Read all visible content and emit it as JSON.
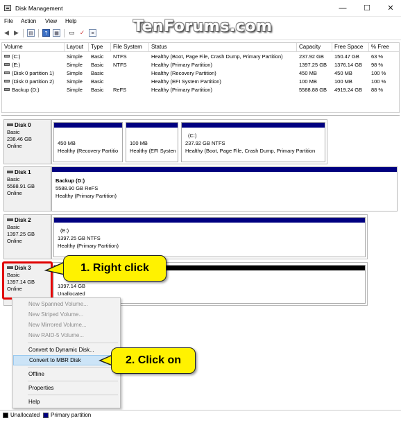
{
  "window": {
    "title": "Disk Management",
    "watermark": "TenForums.com",
    "minimize": "—",
    "maximize": "☐",
    "close": "✕"
  },
  "menu": [
    "File",
    "Action",
    "View",
    "Help"
  ],
  "toolbar_icons": [
    "back-arrow-icon",
    "forward-arrow-icon",
    "properties-icon",
    "help-icon",
    "refresh-icon",
    "disk-icon",
    "check-icon",
    "list-icon"
  ],
  "volume_table": {
    "columns": [
      "Volume",
      "Layout",
      "Type",
      "File System",
      "Status",
      "Capacity",
      "Free Space",
      "% Free"
    ],
    "rows": [
      [
        "(C:)",
        "Simple",
        "Basic",
        "NTFS",
        "Healthy (Boot, Page File, Crash Dump, Primary Partition)",
        "237.92 GB",
        "150.47 GB",
        "63 %"
      ],
      [
        "(E:)",
        "Simple",
        "Basic",
        "NTFS",
        "Healthy (Primary Partition)",
        "1397.25 GB",
        "1376.14 GB",
        "98 %"
      ],
      [
        "(Disk 0 partition 1)",
        "Simple",
        "Basic",
        "",
        "Healthy (Recovery Partition)",
        "450 MB",
        "450 MB",
        "100 %"
      ],
      [
        "(Disk 0 partition 2)",
        "Simple",
        "Basic",
        "",
        "Healthy (EFI System Partition)",
        "100 MB",
        "100 MB",
        "100 %"
      ],
      [
        "Backup (D:)",
        "Simple",
        "Basic",
        "ReFS",
        "Healthy (Primary Partition)",
        "5588.88 GB",
        "4919.24 GB",
        "88 %"
      ]
    ]
  },
  "disks": {
    "disk0": {
      "name": "Disk 0",
      "type": "Basic",
      "size": "238.46 GB",
      "status": "Online",
      "partitions": [
        {
          "name": "",
          "size": "450 MB",
          "status": "Healthy (Recovery Partitio"
        },
        {
          "name": "",
          "size": "100 MB",
          "status": "Healthy (EFI Systen"
        },
        {
          "name": "(C:)",
          "size": "237.92 GB NTFS",
          "status": "Healthy (Boot, Page File, Crash Dump, Primary Partition"
        }
      ]
    },
    "disk1": {
      "name": "Disk 1",
      "type": "Basic",
      "size": "5588.91 GB",
      "status": "Online",
      "partitions": [
        {
          "name": "Backup  (D:)",
          "size": "5588.90 GB ReFS",
          "status": "Healthy (Primary Partition)"
        }
      ]
    },
    "disk2": {
      "name": "Disk 2",
      "type": "Basic",
      "size": "1397.25 GB",
      "status": "Online",
      "partitions": [
        {
          "name": "(E:)",
          "size": "1397.25 GB NTFS",
          "status": "Healthy (Primary Partition)"
        }
      ]
    },
    "disk3": {
      "name": "Disk 3",
      "type": "Basic",
      "size": "1397.14 GB",
      "status": "Online",
      "partitions": [
        {
          "name": "",
          "size": "1397.14 GB",
          "status": "Unallocated"
        }
      ]
    }
  },
  "context_menu": {
    "new_spanned": "New Spanned Volume...",
    "new_striped": "New Striped Volume...",
    "new_mirrored": "New Mirrored Volume...",
    "new_raid5": "New RAID-5 Volume...",
    "convert_dynamic": "Convert to Dynamic Disk...",
    "convert_mbr": "Convert to MBR Disk",
    "offline": "Offline",
    "properties": "Properties",
    "help": "Help"
  },
  "callouts": {
    "step1": "1. Right click",
    "step2": "2. Click on"
  },
  "legend": {
    "unallocated": "Unallocated",
    "primary": "Primary partition"
  },
  "colors": {
    "primary_partition": "#000080",
    "unallocated": "#000000",
    "callout": "#fff200",
    "highlight_box": "#e00000",
    "menu_highlight": "#cce4f7"
  }
}
